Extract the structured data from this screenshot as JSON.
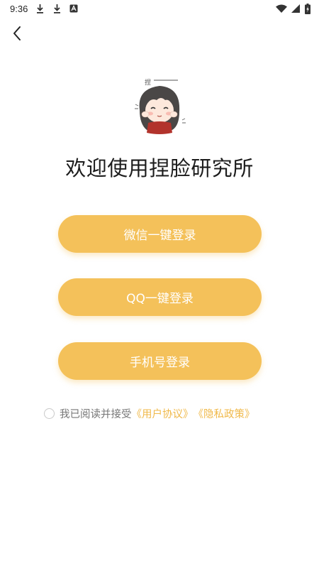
{
  "status_bar": {
    "time": "9:36",
    "icons": [
      "download-icon",
      "download-icon",
      "app-notification-icon",
      "wifi-icon",
      "signal-icon",
      "battery-charging-icon"
    ]
  },
  "nav": {
    "back_icon": "chevron-left-icon"
  },
  "mascot": {
    "icon": "anime-girl-mascot",
    "speech_text": "捏"
  },
  "welcome": {
    "title": "欢迎使用捏脸研究所"
  },
  "login": {
    "wechat_label": "微信一键登录",
    "qq_label": "QQ一键登录",
    "phone_label": "手机号登录"
  },
  "agreement": {
    "prefix": "我已阅读并接受",
    "user_agreement": "《用户协议》",
    "privacy_policy": "《隐私政策》",
    "checked": false
  },
  "colors": {
    "accent": "#f4c15a",
    "link": "#f0b94a",
    "button_text": "#ffffff"
  }
}
